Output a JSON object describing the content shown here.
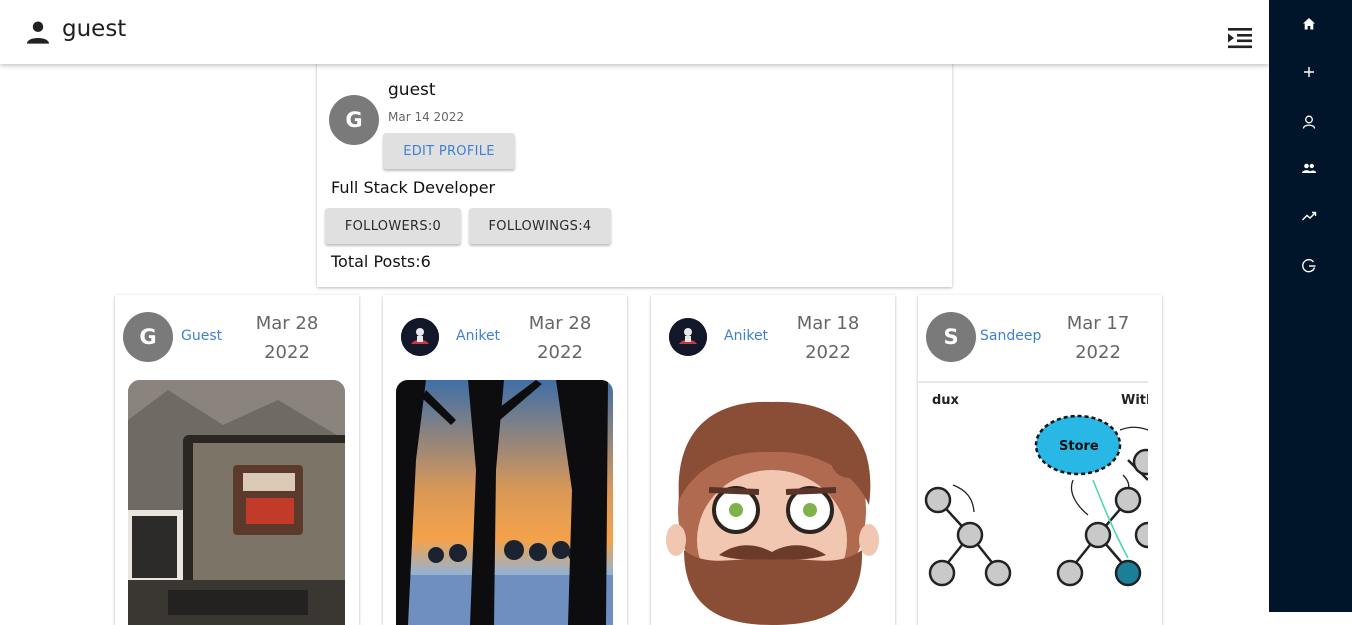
{
  "header": {
    "username": "guest"
  },
  "sidebar": {
    "items": [
      {
        "icon": "home-icon"
      },
      {
        "icon": "plus-icon"
      },
      {
        "icon": "user-icon"
      },
      {
        "icon": "users-icon"
      },
      {
        "icon": "trend-icon"
      },
      {
        "icon": "logout-icon"
      }
    ]
  },
  "profile": {
    "avatar_letter": "G",
    "name": "guest",
    "joined": "Mar 14 2022",
    "edit_label": "EDIT PROFILE",
    "bio": "Full Stack Developer",
    "followers_label": "FOLLOWERS:0",
    "followings_label": "FOLLOWINGS:4",
    "total_posts": "Total Posts:6"
  },
  "posts": [
    {
      "author": "Guest",
      "avatar_letter": "G",
      "date_month_day": "Mar 28",
      "date_year": "2022",
      "image": "laptop-open-sign"
    },
    {
      "author": "Aniket",
      "avatar_letter": "",
      "date_month_day": "Mar 28",
      "date_year": "2022",
      "image": "trees-sunset"
    },
    {
      "author": "Aniket",
      "avatar_letter": "",
      "date_month_day": "Mar 18",
      "date_year": "2022",
      "image": "bearded-cartoon-face"
    },
    {
      "author": "Sandeep",
      "avatar_letter": "S",
      "date_month_day": "Mar 17",
      "date_year": "2022",
      "image": "redux-store-diagram"
    }
  ],
  "redux_diagram": {
    "label_left": "dux",
    "label_right": "With",
    "store_label": "Store"
  },
  "colors": {
    "sidebar_bg": "#001529",
    "link_blue": "#3f7fd3",
    "avatar_gray": "#7a7a7a",
    "button_gray": "#e0e0e0"
  }
}
